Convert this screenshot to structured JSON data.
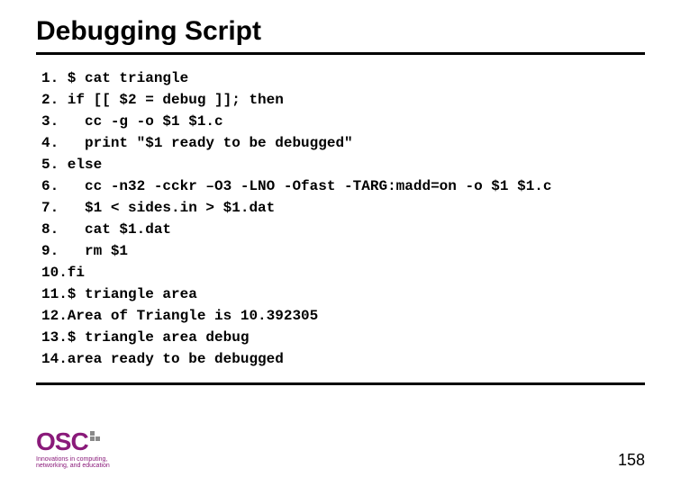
{
  "title": "Debugging Script",
  "code": {
    "lines": [
      "1. $ cat triangle",
      "2. if [[ $2 = debug ]]; then",
      "3.   cc -g -o $1 $1.c",
      "4.   print \"$1 ready to be debugged\"",
      "5. else",
      "6.   cc -n32 -cckr –O3 -LNO -Ofast -TARG:madd=on -o $1 $1.c",
      "7.   $1 < sides.in > $1.dat",
      "8.   cat $1.dat",
      "9.   rm $1",
      "10.fi",
      "11.$ triangle area",
      "12.Area of Triangle is 10.392305",
      "13.$ triangle area debug",
      "14.area ready to be debugged"
    ]
  },
  "logo": {
    "text": "OSC",
    "tagline1": "Innovations in computing,",
    "tagline2": "networking, and education"
  },
  "page_number": "158"
}
